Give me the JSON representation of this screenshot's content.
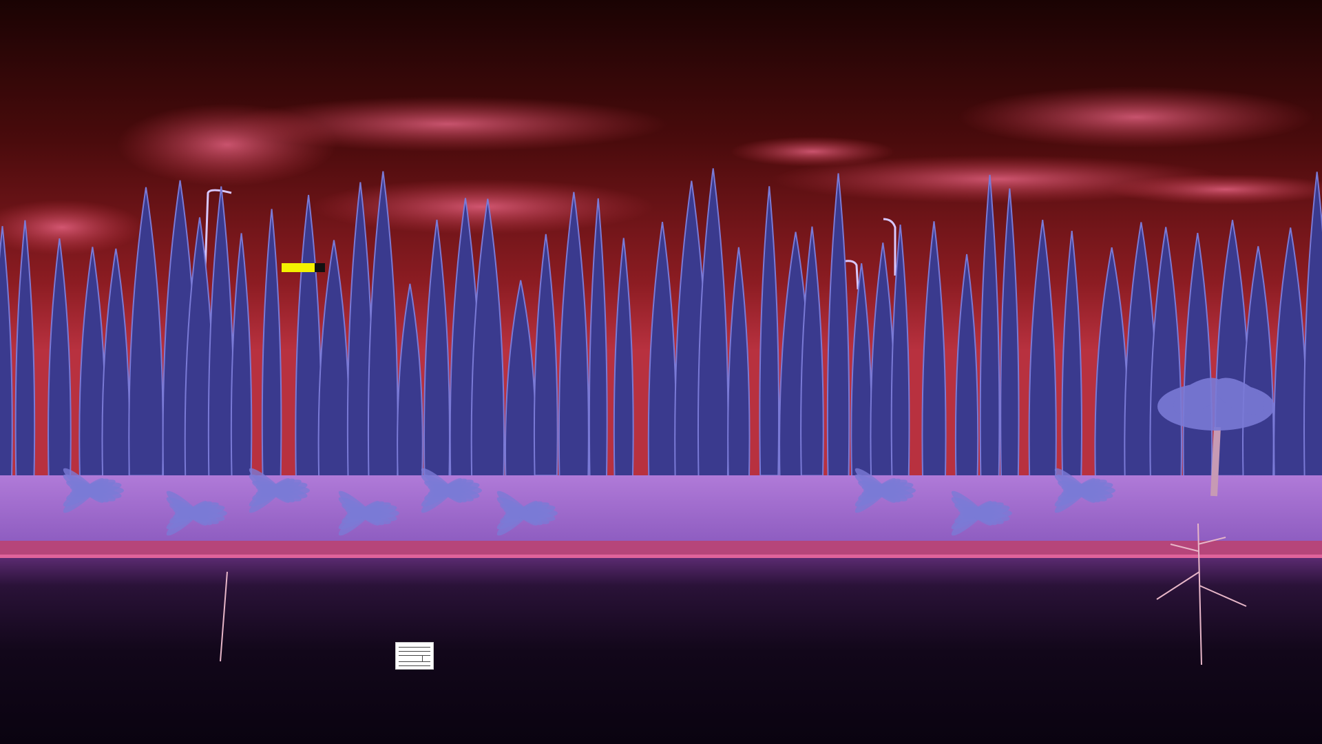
{
  "scene": {
    "description_name": "infrared-cypress-lake",
    "sky_colors": [
      "#2a0506",
      "#7a1416",
      "#c83a4a",
      "#f06a8c"
    ],
    "tree_color": "#3a3a8e",
    "tree_highlight": "#7a7ad6",
    "ground_color": "#b27ad9",
    "bank_color": "#c0456a",
    "water_color": "#120715"
  },
  "overlays": {
    "marker_color": "#f4f100",
    "icon": "document-icon"
  }
}
